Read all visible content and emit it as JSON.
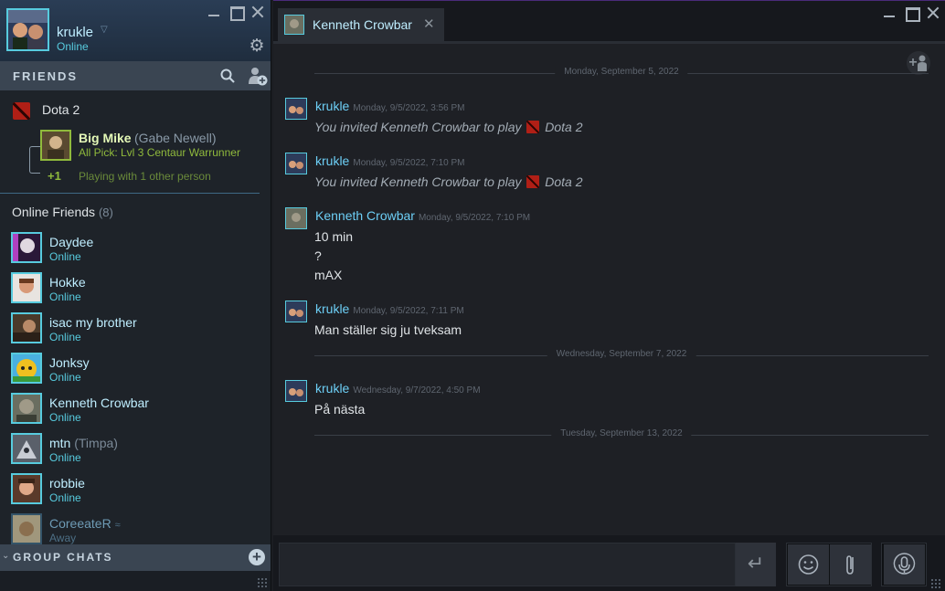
{
  "user": {
    "name": "krukle",
    "status": "Online"
  },
  "friends_bar": {
    "label": "FRIENDS"
  },
  "game_group": {
    "game": "Dota 2",
    "player": {
      "name": "Big Mike",
      "nickname": "(Gabe Newell)",
      "rich_presence": "All Pick: Lvl 3 Centaur Warrunner"
    },
    "party_count": "+1",
    "party_text": "Playing with 1 other person"
  },
  "online": {
    "label": "Online Friends",
    "count": "(8)"
  },
  "friends": [
    {
      "name": "Daydee",
      "nickname": "",
      "status": "Online"
    },
    {
      "name": "Hokke",
      "nickname": "",
      "status": "Online"
    },
    {
      "name": "isac my brother",
      "nickname": "",
      "status": "Online"
    },
    {
      "name": "Jonksy",
      "nickname": "",
      "status": "Online"
    },
    {
      "name": "Kenneth Crowbar",
      "nickname": "",
      "status": "Online"
    },
    {
      "name": "mtn",
      "nickname": "(Timpa)",
      "status": "Online"
    },
    {
      "name": "robbie",
      "nickname": "",
      "status": "Online"
    },
    {
      "name": "CoreeateR",
      "nickname": "",
      "status": "Away"
    }
  ],
  "group_chats": {
    "label": "GROUP CHATS"
  },
  "chat": {
    "tab_name": "Kenneth Crowbar",
    "dates": [
      "Monday, September 5, 2022",
      "Wednesday, September 7, 2022",
      "Tuesday, September 13, 2022"
    ],
    "messages": [
      {
        "sender": "krukle",
        "time": "Monday, 9/5/2022, 3:56 PM",
        "lines": [
          "You invited Kenneth Crowbar to play",
          "Dota 2"
        ]
      },
      {
        "sender": "krukle",
        "time": "Monday, 9/5/2022, 7:10 PM",
        "lines": [
          "You invited Kenneth Crowbar to play",
          "Dota 2"
        ]
      },
      {
        "sender": "Kenneth Crowbar",
        "time": "Monday, 9/5/2022, 7:10 PM",
        "lines": [
          "10 min",
          "?",
          "mAX"
        ]
      },
      {
        "sender": "krukle",
        "time": "Monday, 9/5/2022, 7:11 PM",
        "lines": [
          "Man ställer sig ju tveksam"
        ]
      },
      {
        "sender": "krukle",
        "time": "Wednesday, 9/7/2022, 4:50 PM",
        "lines": [
          "På nästa"
        ]
      }
    ],
    "input": {
      "value": ""
    }
  },
  "colors": {
    "online": "#57cbde",
    "in_game": "#90ba3c",
    "accent": "#6dcff6"
  },
  "icons": [
    "minimize-icon",
    "maximize-icon",
    "close-icon",
    "gear-icon",
    "search-icon",
    "add-friend-icon",
    "dota2-icon",
    "add-group-icon",
    "invite-to-chat-icon",
    "send-icon",
    "emoticon-icon",
    "paperclip-icon",
    "microphone-icon"
  ]
}
